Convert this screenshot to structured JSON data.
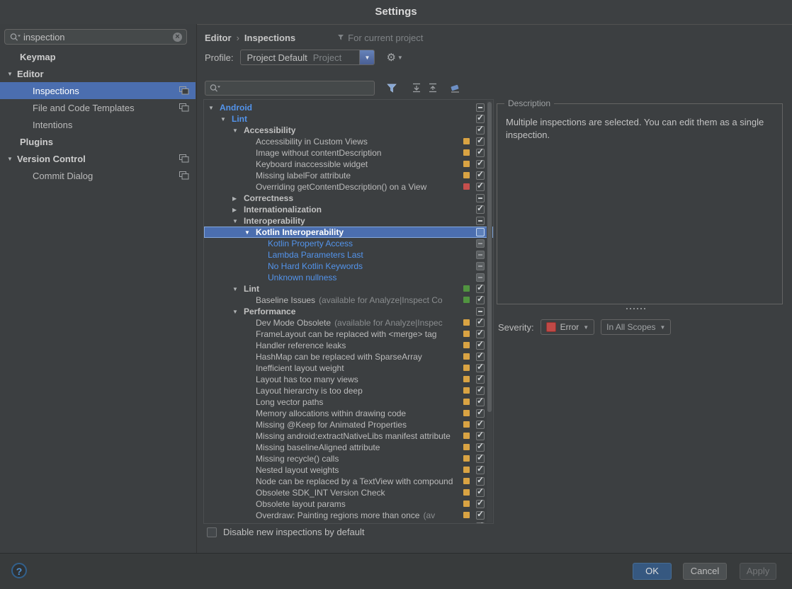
{
  "window": {
    "title": "Settings"
  },
  "colors": {
    "selection_blue": "#4b6eaf",
    "link_blue": "#5394ec",
    "badge_yellow": "#d9a343",
    "badge_red": "#c64f4d",
    "badge_green": "#519440",
    "error_red": "#c04946"
  },
  "sidebar": {
    "search": {
      "value": "inspection",
      "clear_glyph": "×"
    },
    "items": [
      {
        "label": "Keymap",
        "bold": true,
        "indent": 1
      },
      {
        "label": "Editor",
        "bold": true,
        "indent": 0,
        "arrow": "down"
      },
      {
        "label": "Inspections",
        "indent": 2,
        "selected": true,
        "badge_icon": true
      },
      {
        "label": "File and Code Templates",
        "indent": 2,
        "badge_icon": true
      },
      {
        "label": "Intentions",
        "indent": 2
      },
      {
        "label": "Plugins",
        "bold": true,
        "indent": 1
      },
      {
        "label": "Version Control",
        "bold": true,
        "indent": 0,
        "arrow": "down",
        "badge_icon": true
      },
      {
        "label": "Commit Dialog",
        "indent": 2,
        "badge_icon": true
      }
    ]
  },
  "header": {
    "breadcrumb": [
      "Editor",
      "Inspections"
    ],
    "separator": "›",
    "context_note": "For current project",
    "profile_label": "Profile:",
    "profile_value": "Project Default",
    "profile_suffix": "Project"
  },
  "tree": {
    "rows": [
      {
        "label": "Android",
        "level": 0,
        "arrow": "down",
        "style": "bold-blue",
        "check": "partial"
      },
      {
        "label": "Lint",
        "level": 1,
        "arrow": "down",
        "style": "bold-blue",
        "check": "checked"
      },
      {
        "label": "Accessibility",
        "level": 2,
        "arrow": "down",
        "style": "bold",
        "check": "checked"
      },
      {
        "label": "Accessibility in Custom Views",
        "level": 3,
        "style": "normal",
        "badge": "yellow",
        "check": "checked"
      },
      {
        "label": "Image without contentDescription",
        "level": 3,
        "style": "normal",
        "badge": "yellow",
        "check": "checked"
      },
      {
        "label": "Keyboard inaccessible widget",
        "level": 3,
        "style": "normal",
        "badge": "yellow",
        "check": "checked"
      },
      {
        "label": "Missing labelFor attribute",
        "level": 3,
        "style": "normal",
        "badge": "yellow",
        "check": "checked"
      },
      {
        "label": "Overriding getContentDescription() on a View",
        "level": 3,
        "style": "normal",
        "badge": "red",
        "check": "checked"
      },
      {
        "label": "Correctness",
        "level": 2,
        "arrow": "right",
        "style": "bold",
        "check": "partial"
      },
      {
        "label": "Internationalization",
        "level": 2,
        "arrow": "right",
        "style": "bold",
        "check": "checked"
      },
      {
        "label": "Interoperability",
        "level": 2,
        "arrow": "down",
        "style": "bold",
        "check": "partial"
      },
      {
        "label": "Kotlin Interoperability",
        "level": 3,
        "arrow": "down",
        "style": "bold",
        "check": "unchecked",
        "selected": true
      },
      {
        "label": "Kotlin Property Access",
        "level": 4,
        "style": "blue",
        "check": "filled"
      },
      {
        "label": "Lambda Parameters Last",
        "level": 4,
        "style": "blue",
        "check": "filled"
      },
      {
        "label": "No Hard Kotlin Keywords",
        "level": 4,
        "style": "blue",
        "check": "filled"
      },
      {
        "label": "Unknown nullness",
        "level": 4,
        "style": "blue",
        "check": "filled"
      },
      {
        "label": "Lint",
        "level": 2,
        "arrow": "down",
        "style": "bold",
        "badge": "green",
        "check": "checked"
      },
      {
        "label": "Baseline Issues",
        "note": "(available for Analyze|Inspect Co",
        "level": 3,
        "style": "normal",
        "badge": "green",
        "check": "checked"
      },
      {
        "label": "Performance",
        "level": 2,
        "arrow": "down",
        "style": "bold",
        "check": "partial"
      },
      {
        "label": "Dev Mode Obsolete",
        "note": "(available for Analyze|Inspec",
        "level": 3,
        "style": "normal",
        "badge": "yellow",
        "check": "checked"
      },
      {
        "label": "FrameLayout can be replaced with <merge> tag",
        "level": 3,
        "style": "normal",
        "badge": "yellow",
        "check": "checked"
      },
      {
        "label": "Handler reference leaks",
        "level": 3,
        "style": "normal",
        "badge": "yellow",
        "check": "checked"
      },
      {
        "label": "HashMap can be replaced with SparseArray",
        "level": 3,
        "style": "normal",
        "badge": "yellow",
        "check": "checked"
      },
      {
        "label": "Inefficient layout weight",
        "level": 3,
        "style": "normal",
        "badge": "yellow",
        "check": "checked"
      },
      {
        "label": "Layout has too many views",
        "level": 3,
        "style": "normal",
        "badge": "yellow",
        "check": "checked"
      },
      {
        "label": "Layout hierarchy is too deep",
        "level": 3,
        "style": "normal",
        "badge": "yellow",
        "check": "checked"
      },
      {
        "label": "Long vector paths",
        "level": 3,
        "style": "normal",
        "badge": "yellow",
        "check": "checked"
      },
      {
        "label": "Memory allocations within drawing code",
        "level": 3,
        "style": "normal",
        "badge": "yellow",
        "check": "checked"
      },
      {
        "label": "Missing @Keep for Animated Properties",
        "level": 3,
        "style": "normal",
        "badge": "yellow",
        "check": "checked"
      },
      {
        "label": "Missing android:extractNativeLibs manifest attribute",
        "level": 3,
        "style": "normal",
        "badge": "yellow",
        "check": "checked"
      },
      {
        "label": "Missing baselineAligned attribute",
        "level": 3,
        "style": "normal",
        "badge": "yellow",
        "check": "checked"
      },
      {
        "label": "Missing recycle() calls",
        "level": 3,
        "style": "normal",
        "badge": "yellow",
        "check": "checked"
      },
      {
        "label": "Nested layout weights",
        "level": 3,
        "style": "normal",
        "badge": "yellow",
        "check": "checked"
      },
      {
        "label": "Node can be replaced by a TextView with compound",
        "level": 3,
        "style": "normal",
        "badge": "yellow",
        "check": "checked"
      },
      {
        "label": "Obsolete SDK_INT Version Check",
        "level": 3,
        "style": "normal",
        "badge": "yellow",
        "check": "checked"
      },
      {
        "label": "Obsolete layout params",
        "level": 3,
        "style": "normal",
        "badge": "yellow",
        "check": "checked"
      },
      {
        "label": "Overdraw: Painting regions more than once",
        "note": "(av",
        "level": 3,
        "style": "normal",
        "badge": "yellow",
        "check": "checked"
      },
      {
        "label": "",
        "level": 3,
        "style": "normal",
        "badge": "yellow",
        "check": "checked"
      }
    ]
  },
  "description": {
    "title": "Description",
    "text": "Multiple inspections are selected. You can edit them as a single inspection."
  },
  "severity": {
    "label": "Severity:",
    "value": "Error",
    "scope": "In All Scopes"
  },
  "options": {
    "disable_new": "Disable new inspections by default"
  },
  "footer": {
    "help": "?",
    "ok": "OK",
    "cancel": "Cancel",
    "apply": "Apply"
  }
}
